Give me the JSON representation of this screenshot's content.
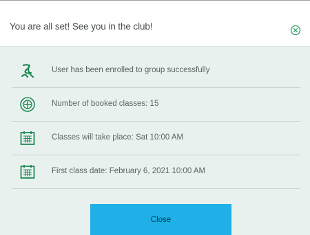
{
  "dialog": {
    "title": "You are all set! See you in the club!",
    "close_icon": "close-circle-icon"
  },
  "items": [
    {
      "icon": "swirl-check-icon",
      "label": "User has been enrolled to group successfully"
    },
    {
      "icon": "ticket-circle-icon",
      "label": "Number of booked classes: 15"
    },
    {
      "icon": "calendar-icon",
      "label": "Classes will take place: Sat 10:00 AM"
    },
    {
      "icon": "calendar-icon",
      "label": "First class date: February 6, 2021 10:00 AM"
    }
  ],
  "footer": {
    "close_label": "Close"
  },
  "colors": {
    "accent_green": "#1f8a55",
    "button_blue": "#1eb0e6"
  }
}
